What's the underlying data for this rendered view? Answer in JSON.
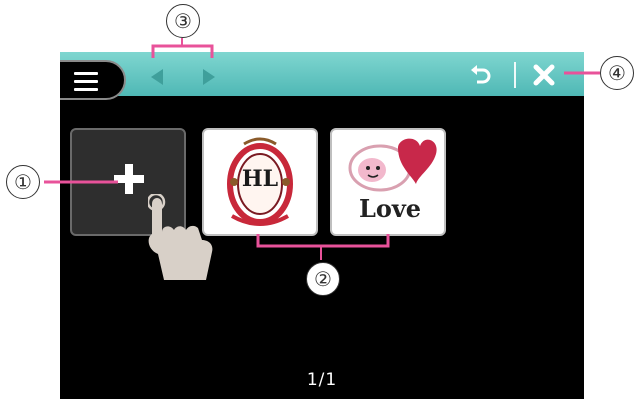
{
  "screen": {
    "background_color": "#000000",
    "topbar_color": "#5cc4c0",
    "accent_color": "#e8529a"
  },
  "topbar": {
    "menu_icon": "hamburger-menu-icon",
    "prev_icon": "arrow-left-icon",
    "next_icon": "arrow-right-icon",
    "undo_icon": "undo-icon",
    "close_icon": "close-x-icon"
  },
  "tiles": [
    {
      "type": "add",
      "icon": "plus-icon"
    },
    {
      "type": "design",
      "name": "monogram-frame",
      "text": "HL"
    },
    {
      "type": "design",
      "name": "love-heart",
      "text": "Love"
    }
  ],
  "pager": {
    "label": "1/1"
  },
  "callouts": [
    "①",
    "②",
    "③",
    "④"
  ]
}
